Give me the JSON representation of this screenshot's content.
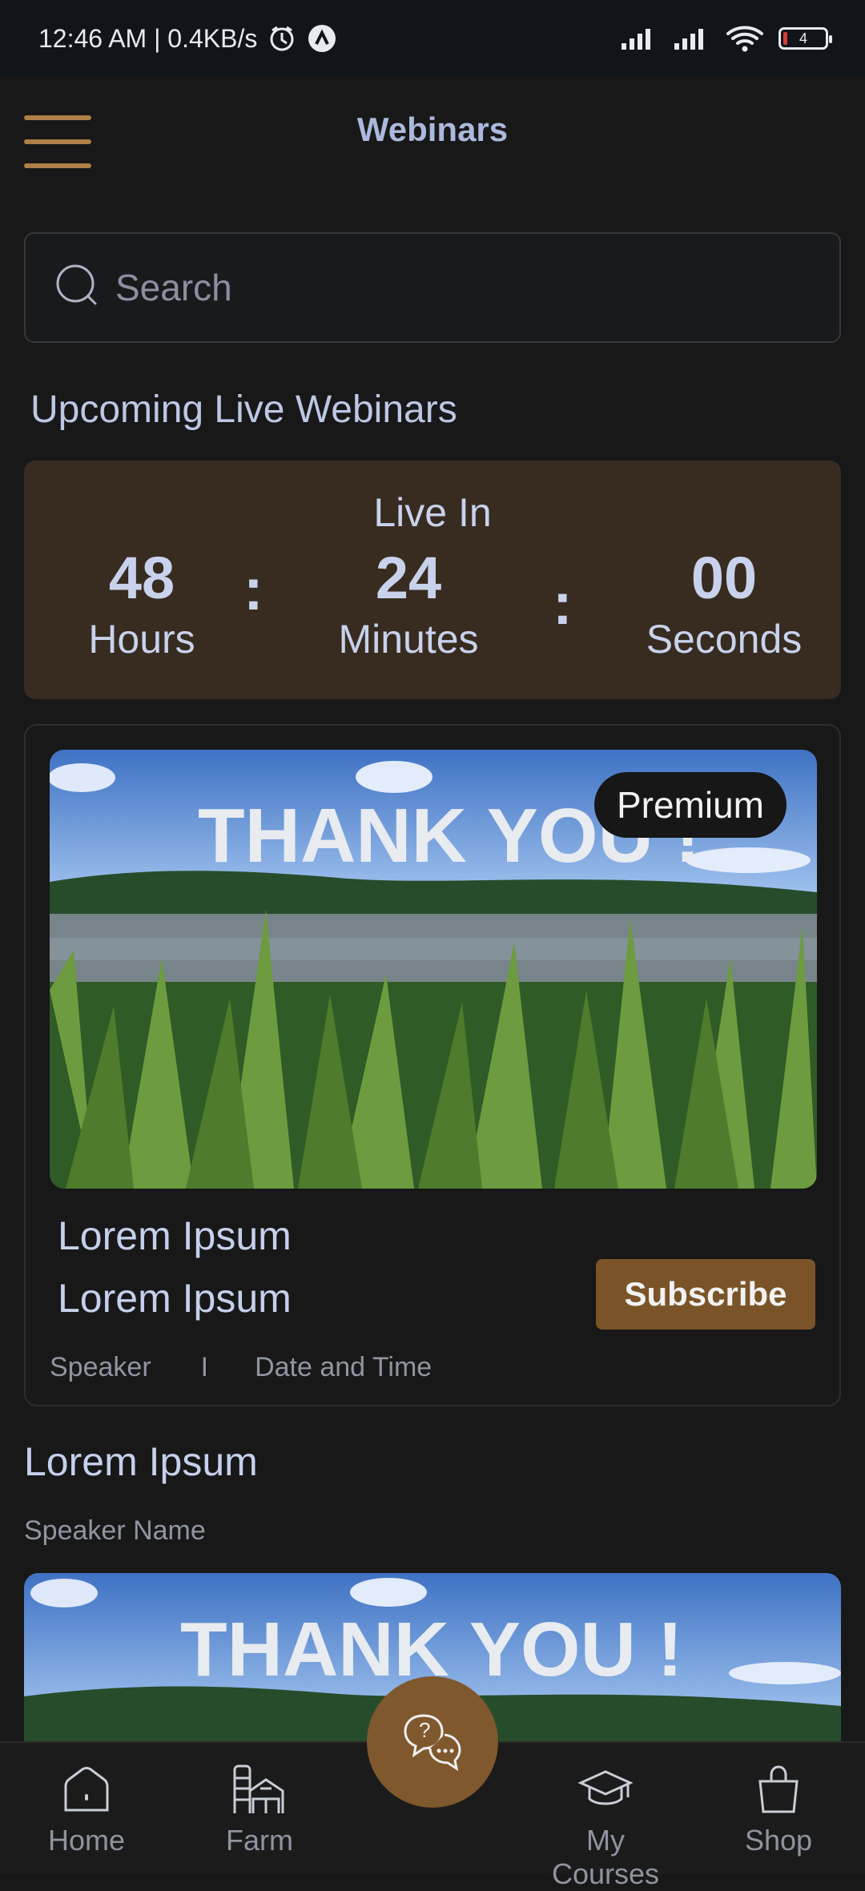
{
  "status_bar": {
    "time_speed": "12:46 AM | 0.4KB/s",
    "battery_level": "4",
    "icons": [
      "alarm-icon",
      "vpn-icon",
      "signal-icon",
      "signal-icon",
      "wifi-icon",
      "battery-icon"
    ]
  },
  "header": {
    "title": "Webinars",
    "menu_icon": "menu-icon"
  },
  "search": {
    "placeholder": "Search",
    "icon": "search-icon"
  },
  "upcoming": {
    "title": "Upcoming Live Webinars"
  },
  "countdown": {
    "label": "Live In",
    "hours": "48",
    "hours_label": "Hours",
    "minutes": "24",
    "minutes_label": "Minutes",
    "seconds": "00",
    "seconds_label": "Seconds",
    "separator": ":"
  },
  "webinar_card": {
    "image_text": "THANK YOU !",
    "badge": "Premium",
    "title_1": "Lorem Ipsum",
    "title_2": "Lorem Ipsum",
    "button": "Subscribe",
    "speaker": "Speaker",
    "separator": "I",
    "date_time": "Date and Time"
  },
  "second_card": {
    "title": "Lorem Ipsum",
    "speaker": "Speaker Name",
    "image_text": "THANK YOU !"
  },
  "bottom_nav": {
    "items": [
      {
        "label": "Home",
        "icon": "home-icon"
      },
      {
        "label": "Farm",
        "icon": "farm-icon"
      },
      {
        "label": "My Courses",
        "icon": "graduation-cap-icon"
      },
      {
        "label": "Shop",
        "icon": "shopping-bag-icon"
      }
    ],
    "fab_icon": "chat-question-icon"
  },
  "colors": {
    "background": "#181818",
    "accent_brown": "#7a5428",
    "countdown_bg": "#382b20",
    "title_blue": "#aab9dd"
  }
}
